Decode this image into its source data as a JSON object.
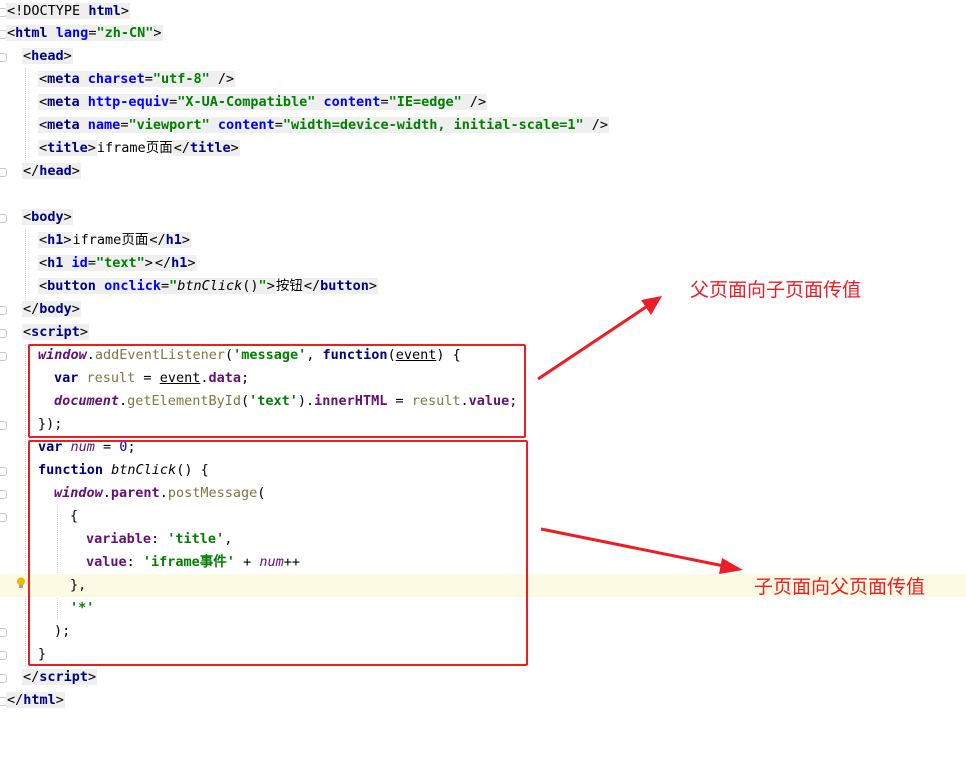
{
  "editor": {
    "doctype": {
      "open": "<!",
      "kw": "DOCTYPE",
      "name": "html",
      "close": ">"
    },
    "html_tag": {
      "open": "<",
      "name": "html",
      "attr": "lang",
      "eq": "=",
      "val": "\"zh-CN\"",
      "close": ">"
    },
    "head_open": {
      "open": "<",
      "name": "head",
      "close": ">"
    },
    "meta1": {
      "open": "<",
      "name": "meta",
      "attr": "charset",
      "eq": "=",
      "val": "\"utf-8\"",
      "close": " />"
    },
    "meta2": {
      "open": "<",
      "name": "meta",
      "attr1": "http-equiv",
      "eq1": "=",
      "val1": "\"X-UA-Compatible\"",
      "attr2": "content",
      "eq2": "=",
      "val2": "\"IE=edge\"",
      "close": " />"
    },
    "meta3": {
      "open": "<",
      "name": "meta",
      "attr1": "name",
      "eq1": "=",
      "val1": "\"viewport\"",
      "attr2": "content",
      "eq2": "=",
      "val2": "\"width=device-width, initial-scale=1\"",
      "close": " />"
    },
    "title": {
      "open": "<",
      "name": "title",
      "close": ">",
      "text": "iframe页面",
      "end_open": "</",
      "end_name": "title",
      "end_close": ">"
    },
    "head_close": {
      "open": "</",
      "name": "head",
      "close": ">"
    },
    "body_open": {
      "open": "<",
      "name": "body",
      "close": ">"
    },
    "h1a": {
      "open": "<",
      "name": "h1",
      "close": ">",
      "text": "iframe页面",
      "end_open": "</",
      "end_name": "h1",
      "end_close": ">"
    },
    "h1b": {
      "open": "<",
      "name": "h1",
      "attr": "id",
      "eq": "=",
      "val": "\"text\"",
      "close": ">",
      "end_open": "</",
      "end_name": "h1",
      "end_close": ">"
    },
    "button": {
      "open": "<",
      "name": "button",
      "attr": "onclick",
      "eq": "=",
      "q1": "\"",
      "fn": "btnClick",
      "paren": "()",
      "q2": "\"",
      "close": ">",
      "text": "按钮",
      "end_open": "</",
      "end_name": "button",
      "end_close": ">"
    },
    "body_close": {
      "open": "</",
      "name": "body",
      "close": ">"
    },
    "script_open": {
      "open": "<",
      "name": "script",
      "close": ">"
    },
    "js1": {
      "obj": "window",
      "dot": ".",
      "method": "addEventListener",
      "p1": "(",
      "str": "'message'",
      "comma": ", ",
      "kw": "function",
      "p2": "(",
      "arg": "event",
      "p3": ") {"
    },
    "js2": {
      "kw": "var ",
      "name": "result",
      "eq": " = ",
      "obj": "event",
      "dot": ".",
      "prop": "data",
      "semi": ";"
    },
    "js3": {
      "obj": "document",
      "dot1": ".",
      "method": "getElementById",
      "p1": "(",
      "str": "'text'",
      "p2": ")",
      "dot2": ".",
      "prop": "innerHTML",
      "eq": " = ",
      "name": "result",
      "dot3": ".",
      "prop2": "value",
      "semi": ";"
    },
    "js4": "});",
    "js5": {
      "kw": "var ",
      "name": "num",
      "eq": " = ",
      "num": "0",
      "semi": ";"
    },
    "js6": {
      "kw": "function ",
      "name": "btnClick",
      "rest": "() {"
    },
    "js7": {
      "obj": "window",
      "dot1": ".",
      "prop": "parent",
      "dot2": ".",
      "method": "postMessage",
      "p": "("
    },
    "js8": "{",
    "js9": {
      "prop": "variable",
      "colon": ": ",
      "str": "'title'",
      "comma": ","
    },
    "js10": {
      "prop": "value",
      "colon": ": ",
      "str": "'iframe事件'",
      "plus": " + ",
      "name": "num",
      "op": "++"
    },
    "js11": "},",
    "js12": "'*'",
    "js13": ");",
    "js14": "}",
    "script_close": {
      "open": "</",
      "name": "script",
      "close": ">"
    },
    "html_close": {
      "open": "</",
      "name": "html",
      "close": ">"
    }
  },
  "annotations": {
    "top_note": "父页面向子页面传值",
    "bottom_note": "子页面向父页面传值"
  },
  "colors": {
    "annotation_red": "#ee1c24",
    "tag_navy": "#000080",
    "attr_blue": "#0000ff",
    "string_green": "#008000",
    "global_purple": "#660e7a",
    "current_line": "#fdfae4"
  },
  "icons": {
    "gutter_bulb": "lightbulb-icon",
    "gutter_fold": "fold-marker-icon",
    "arrows": "arrow-icon"
  }
}
